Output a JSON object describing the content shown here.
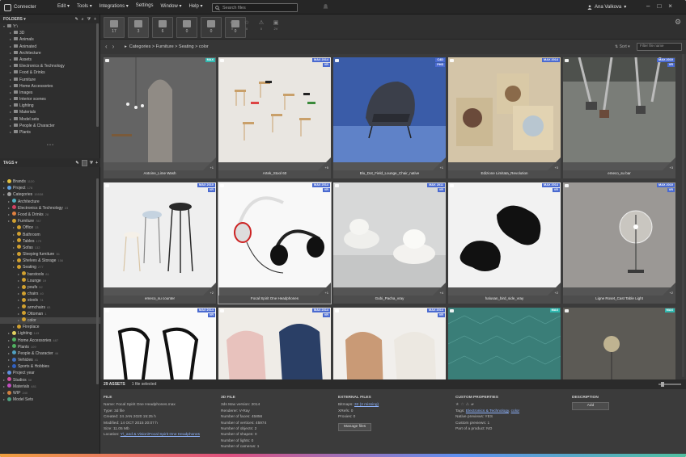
{
  "app": {
    "name": "Connecter"
  },
  "menu": [
    "Edit ▾",
    "Tools ▾",
    "Integrations ▾",
    "Settings",
    "Window ▾",
    "Help ▾"
  ],
  "search": {
    "placeholder": "Search files"
  },
  "user": {
    "name": "Ana Valkova",
    "caret": "▾"
  },
  "folders": {
    "title": "FOLDERS ▾",
    "items": [
      {
        "label": "Y:\\",
        "count": ""
      },
      {
        "label": "3D",
        "count": ""
      },
      {
        "label": "Animals",
        "count": ""
      },
      {
        "label": "Animated",
        "count": ""
      },
      {
        "label": "Architecture",
        "count": ""
      },
      {
        "label": "Assets",
        "count": ""
      },
      {
        "label": "Electronics & Technology",
        "count": ""
      },
      {
        "label": "Food & Drinks",
        "count": ""
      },
      {
        "label": "Furniture",
        "count": ""
      },
      {
        "label": "Home Accessories",
        "count": ""
      },
      {
        "label": "Images",
        "count": ""
      },
      {
        "label": "Interior scenes",
        "count": ""
      },
      {
        "label": "Lighting",
        "count": ""
      },
      {
        "label": "Materials",
        "count": ""
      },
      {
        "label": "Model sets",
        "count": ""
      },
      {
        "label": "People & Character",
        "count": ""
      },
      {
        "label": "Plants",
        "count": ""
      }
    ]
  },
  "tags": {
    "title": "TAGS ▾",
    "items": [
      {
        "label": "Brands",
        "count": "1120",
        "color": "#e0c040",
        "indent": 1
      },
      {
        "label": "Project",
        "count": "178",
        "color": "#60a0e0",
        "indent": 1
      },
      {
        "label": "Categories",
        "count": "15538",
        "color": "#a0a0a0",
        "indent": 1
      },
      {
        "label": "Architecture",
        "count": "",
        "color": "#50b0c0",
        "indent": 2
      },
      {
        "label": "Electronics & Technology",
        "count": "23",
        "color": "#d04060",
        "indent": 2
      },
      {
        "label": "Food & Drinks",
        "count": "28",
        "color": "#e08040",
        "indent": 2
      },
      {
        "label": "Furniture",
        "count": "787",
        "color": "#d0a030",
        "indent": 2
      },
      {
        "label": "Office",
        "count": "13",
        "color": "#d0a030",
        "indent": 3
      },
      {
        "label": "Bathroom",
        "count": "",
        "color": "#d0a030",
        "indent": 3
      },
      {
        "label": "Tables",
        "count": "179",
        "color": "#d0a030",
        "indent": 3
      },
      {
        "label": "Sofas",
        "count": "132",
        "color": "#d0a030",
        "indent": 3
      },
      {
        "label": "Sleeping furniture",
        "count": "35",
        "color": "#d0a030",
        "indent": 3
      },
      {
        "label": "Shelves & Storage",
        "count": "156",
        "color": "#d0a030",
        "indent": 3
      },
      {
        "label": "Seating",
        "count": "277",
        "color": "#d0a030",
        "indent": 3
      },
      {
        "label": "barstools",
        "count": "81",
        "color": "#d0a030",
        "indent": 4
      },
      {
        "label": "Lounge",
        "count": "19",
        "color": "#d0a030",
        "indent": 4
      },
      {
        "label": "poufs",
        "count": "52",
        "color": "#d0a030",
        "indent": 4
      },
      {
        "label": "chairs",
        "count": "40",
        "color": "#d0a030",
        "indent": 4
      },
      {
        "label": "stools",
        "count": "74",
        "color": "#d0a030",
        "indent": 4
      },
      {
        "label": "armchairs",
        "count": "83",
        "color": "#d0a030",
        "indent": 4
      },
      {
        "label": "Ottoman",
        "count": "1",
        "color": "#d0a030",
        "indent": 4
      },
      {
        "label": "color",
        "count": "",
        "color": "#d0a030",
        "indent": 4,
        "selected": true
      },
      {
        "label": "Fireplace",
        "count": "",
        "color": "#d0a030",
        "indent": 3
      },
      {
        "label": "Lighting",
        "count": "143",
        "color": "#e0d060",
        "indent": 2
      },
      {
        "label": "Home Accessories",
        "count": "487",
        "color": "#50b060",
        "indent": 2
      },
      {
        "label": "Plants",
        "count": "109",
        "color": "#50b060",
        "indent": 2
      },
      {
        "label": "People & Character",
        "count": "46",
        "color": "#50a0c0",
        "indent": 2
      },
      {
        "label": "Vehicles",
        "count": "41",
        "color": "#4070c0",
        "indent": 2
      },
      {
        "label": "Sports & Hobbies",
        "count": "",
        "color": "#3060c0",
        "indent": 2
      },
      {
        "label": "Project year",
        "count": "",
        "color": "#6090e0",
        "indent": 1
      },
      {
        "label": "Studios",
        "count": "58",
        "color": "#d050a0",
        "indent": 1
      },
      {
        "label": "Materials",
        "count": "481",
        "color": "#c050c0",
        "indent": 1
      },
      {
        "label": "WIP",
        "count": "240",
        "color": "#d08040",
        "indent": 1
      },
      {
        "label": "Model Sets",
        "count": "",
        "color": "#50a080",
        "indent": 1
      }
    ]
  },
  "filters": [
    {
      "count": "17"
    },
    {
      "count": "3"
    },
    {
      "count": "6"
    },
    {
      "count": "0"
    },
    {
      "count": "0"
    },
    {
      "count": "0"
    }
  ],
  "stars": [
    {
      "icon": "★",
      "count": "0"
    },
    {
      "icon": "☆",
      "count": "0"
    },
    {
      "icon": "⚠",
      "count": "0"
    },
    {
      "icon": "▣",
      "count": "2V"
    }
  ],
  "breadcrumb": "Categories > Furniture > Seating > color",
  "sort": {
    "label": "Sort ▾"
  },
  "filter_input": {
    "placeholder": "Filter file name"
  },
  "assets": [
    {
      "name": "Antoine_Lime Wash",
      "badge1": "MAX",
      "badge1_color": "#30b8b0",
      "badge2": "",
      "plus": "+1",
      "scene": "arch"
    },
    {
      "name": "Artek_Stool 60",
      "badge1": "MAX 2014",
      "badge1_color": "#4a6ad0",
      "badge2": "VR",
      "plus": "+5",
      "scene": "stools"
    },
    {
      "name": "Blu_Dot_Field_Lounge_Chair_native",
      "badge1": "C4D",
      "badge1_color": "#4a6ad0",
      "badge2": "PHS",
      "plus": "+1",
      "scene": "lounge"
    },
    {
      "name": "Edizione Limitata_Revolution",
      "badge1": "MAX 2014",
      "badge1_color": "#4a6ad0",
      "badge2": "",
      "plus": "+3",
      "scene": "cubes"
    },
    {
      "name": "emeco_su bar",
      "badge1": "MAX 2010",
      "badge1_color": "#4a6ad0",
      "badge2": "VR",
      "plus": "+3",
      "scene": "hanging"
    },
    {
      "name": "emeco_su counter",
      "badge1": "MAX 2010",
      "badge1_color": "#4a6ad0",
      "badge2": "VR",
      "plus": "+2",
      "scene": "barstools"
    },
    {
      "name": "Focal Spirit One Headphones",
      "badge1": "MAX 2014",
      "badge1_color": "#4a6ad0",
      "badge2": "VR",
      "plus": "+1",
      "scene": "headphones",
      "selected": true
    },
    {
      "name": "Gubi_Pacha_vray",
      "badge1": "MAX 2011",
      "badge1_color": "#4a6ad0",
      "badge2": "VR",
      "plus": "+4",
      "scene": "pacha"
    },
    {
      "name": "halusan_bird_side_vray",
      "badge1": "MAX 2014",
      "badge1_color": "#4a6ad0",
      "badge2": "VR",
      "plus": "+2",
      "scene": "birds"
    },
    {
      "name": "Ligne Roset_Cast Table Light",
      "badge1": "MAX 2010",
      "badge1_color": "#4a6ad0",
      "badge2": "VR",
      "plus": "+2",
      "scene": "lamp"
    },
    {
      "name": "",
      "badge1": "MAX 2014",
      "badge1_color": "#4a6ad0",
      "badge2": "VR",
      "plus": "",
      "scene": "vases"
    },
    {
      "name": "",
      "badge1": "MAX 2014",
      "badge1_color": "#4a6ad0",
      "badge2": "VR",
      "plus": "",
      "scene": "armchairs"
    },
    {
      "name": "",
      "badge1": "MAX 2014",
      "badge1_color": "#4a6ad0",
      "badge2": "VR",
      "plus": "",
      "scene": "wood"
    },
    {
      "name": "",
      "badge1": "MAX",
      "badge1_color": "#30b8b0",
      "badge2": "",
      "plus": "",
      "scene": "tiles"
    },
    {
      "name": "",
      "badge1": "MAX",
      "badge1_color": "#30b8b0",
      "badge2": "",
      "plus": "",
      "scene": "dark"
    }
  ],
  "status": {
    "assets": "29 ASSETS",
    "selected": "1 file selected"
  },
  "info": {
    "file": {
      "heading": "FILE",
      "lines": [
        "Name: Focal Spirit One Headphones.max",
        "Type: 3d file",
        "Created: 24 JAN 2020 15:25 h",
        "Modified: 14 OCT 2015 20:07 h",
        "Size: 11.05 Mb"
      ],
      "location_label": "Location: ",
      "location_link": "Y\\_and & Vision\\Focal Spirit One Headphones"
    },
    "threed": {
      "heading": "3D FILE",
      "lines": [
        "3ds Max version: 2014",
        "Renderer: V-Ray",
        "Number of faces: 45856",
        "Number of vertices: 45974",
        "Number of objects: 2",
        "Number of shapes: 0",
        "Number of lights: 0",
        "Number of cameras: 1"
      ]
    },
    "external": {
      "heading": "EXTERNAL FILES",
      "bitmaps_label": "Bitmaps: ",
      "bitmaps_link": "32 (2 missing)",
      "lines": [
        "XRefs: 0",
        "Proxies: 0"
      ],
      "button": "Manage files"
    },
    "custom": {
      "heading": "CUSTOM PROPERTIES",
      "tags_label": "Tags: ",
      "tags_link1": "Electronics & Technology",
      "tags_sep": ", ",
      "tags_link2": "color",
      "lines": [
        "Native previews: YES",
        "Custom previews: 1",
        "Part of a product: NO"
      ]
    },
    "description": {
      "heading": "DESCRIPTION",
      "button": "Add"
    }
  }
}
